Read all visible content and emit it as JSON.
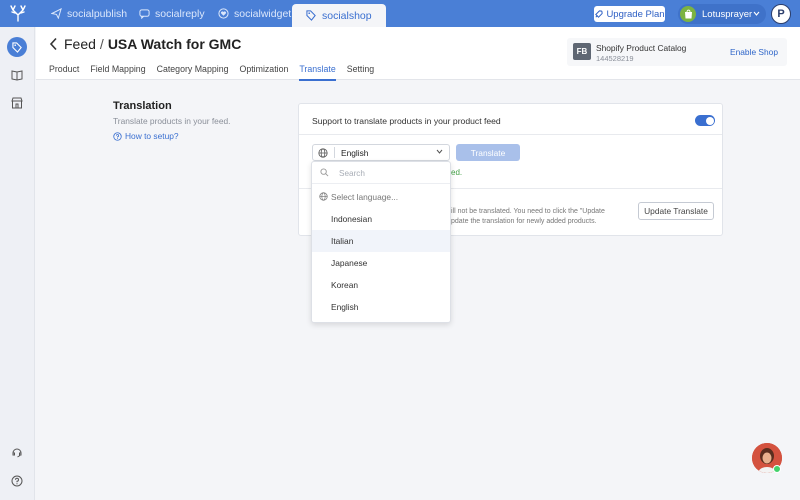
{
  "topnav": {
    "items": [
      {
        "label": "socialpublish",
        "icon": "send-icon"
      },
      {
        "label": "socialreply",
        "icon": "chat-icon"
      },
      {
        "label": "socialwidget",
        "icon": "heart-icon"
      },
      {
        "label": "socialshop",
        "icon": "tag-icon",
        "active": true
      }
    ],
    "upgrade_label": "Upgrade Plan",
    "user_name": "Lotusprayer",
    "avatar_letter": "P"
  },
  "header": {
    "feed_label": "Feed",
    "separator": "/",
    "feed_name": "USA Watch for GMC",
    "tabs": [
      "Product",
      "Field Mapping",
      "Category Mapping",
      "Optimization",
      "Translate",
      "Setting"
    ],
    "active_tab": "Translate",
    "catalog": {
      "badge": "FB",
      "name": "Shopify Product Catalog",
      "id": "144528219",
      "enable_label": "Enable Shop"
    }
  },
  "section": {
    "title": "Translation",
    "description": "Translate products in your feed.",
    "howto": "How to setup?"
  },
  "card": {
    "toggle_label": "Support to translate products in your product feed",
    "toggle_on": true,
    "selected_language": "English",
    "translate_btn": "Translate",
    "hint_visible": "ed.",
    "note_line1": "ill not be translated. You need to click the \"Update",
    "note_line2": "pdate the translation for newly added products.",
    "update_btn": "Update Translate"
  },
  "dropdown": {
    "search_placeholder": "Search",
    "select_label": "Select language...",
    "options": [
      "Indonesian",
      "Italian",
      "Japanese",
      "Korean",
      "English"
    ],
    "hovered": "Italian"
  },
  "colors": {
    "topbar": "#4a7fd6",
    "accent": "#3a6fd0",
    "success": "#43a047"
  }
}
